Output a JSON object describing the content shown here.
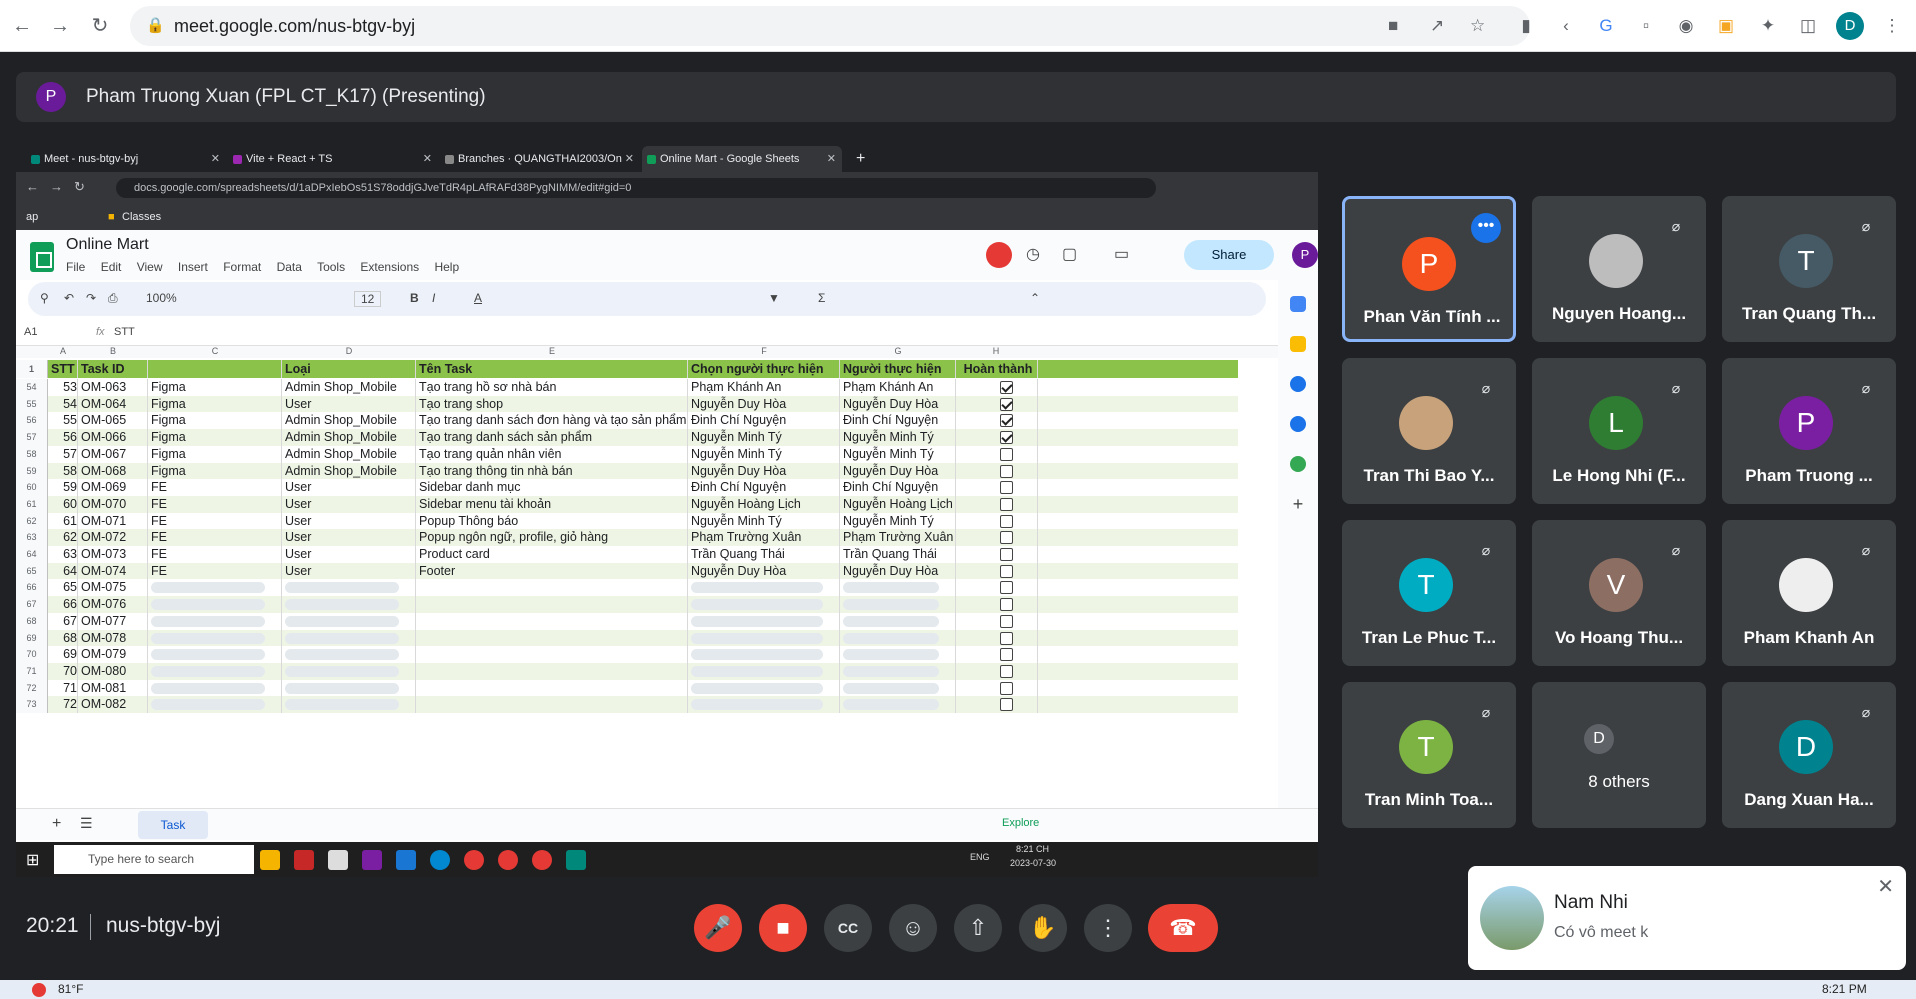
{
  "browser": {
    "url": "meet.google.com/nus-btgv-byj",
    "profile_initial": "D"
  },
  "presenting": {
    "avatar_initial": "P",
    "title": "Pham Truong Xuan (FPL CT_K17) (Presenting)"
  },
  "shared": {
    "tabs": [
      {
        "label": "Meet - nus-btgv-byj"
      },
      {
        "label": "Vite + React + TS"
      },
      {
        "label": "Branches · QUANGTHAI2003/On"
      },
      {
        "label": "Online Mart - Google Sheets"
      }
    ],
    "address": "docs.google.com/spreadsheets/d/1aDPxIebOs51S78oddjGJveTdR4pLAfRAFd38PygNIMM/edit#gid=0",
    "bookmarks": [
      "ap",
      "Classes"
    ],
    "doc_title": "Online Mart",
    "menu": [
      "File",
      "Edit",
      "View",
      "Insert",
      "Format",
      "Data",
      "Tools",
      "Extensions",
      "Help"
    ],
    "share_label": "Share",
    "account_initial": "P",
    "zoom": "100%",
    "font_size": "12",
    "cell_ref": "A1",
    "formula": "STT",
    "col_letters": [
      "A",
      "B",
      "C",
      "D",
      "E",
      "F",
      "G",
      "H"
    ],
    "header": [
      "STT",
      "Task ID",
      "",
      "Loại",
      "Tên Task",
      "Chọn người thực hiện",
      "Người thực hiện",
      "Hoàn thành"
    ],
    "rows": [
      {
        "n": "54",
        "stt": "53",
        "id": "OM-063",
        "c": "Figma",
        "loai": "Admin Shop_Mobile",
        "task": "Tạo trang hồ sơ nhà bán",
        "chon": "Phạm Khánh An",
        "nguoi": "Phạm Khánh An",
        "done": true
      },
      {
        "n": "55",
        "stt": "54",
        "id": "OM-064",
        "c": "Figma",
        "loai": "User",
        "task": "Tạo trang shop",
        "chon": "Nguyễn Duy Hòa",
        "nguoi": "Nguyễn Duy Hòa",
        "done": true
      },
      {
        "n": "56",
        "stt": "55",
        "id": "OM-065",
        "c": "Figma",
        "loai": "Admin Shop_Mobile",
        "task": "Tạo trang danh sách đơn hàng và tạo sản phẩm",
        "chon": "Đinh Chí Nguyện",
        "nguoi": "Đinh Chí Nguyện",
        "done": true
      },
      {
        "n": "57",
        "stt": "56",
        "id": "OM-066",
        "c": "Figma",
        "loai": "Admin Shop_Mobile",
        "task": "Tạo trang danh sách sản phẩm",
        "chon": "Nguyễn Minh Tý",
        "nguoi": "Nguyễn Minh Tý",
        "done": true
      },
      {
        "n": "58",
        "stt": "57",
        "id": "OM-067",
        "c": "Figma",
        "loai": "Admin Shop_Mobile",
        "task": "Tạo trang quản nhân viên",
        "chon": "Nguyễn Minh Tý",
        "nguoi": "Nguyễn Minh Tý",
        "done": false
      },
      {
        "n": "59",
        "stt": "58",
        "id": "OM-068",
        "c": "Figma",
        "loai": "Admin Shop_Mobile",
        "task": "Tạo trang thông tin nhà bán",
        "chon": "Nguyễn Duy Hòa",
        "nguoi": "Nguyễn Duy Hòa",
        "done": false
      },
      {
        "n": "60",
        "stt": "59",
        "id": "OM-069",
        "c": "FE",
        "loai": "User",
        "task": "Sidebar danh mục",
        "chon": "Đinh Chí Nguyện",
        "nguoi": "Đinh Chí Nguyện",
        "done": false
      },
      {
        "n": "61",
        "stt": "60",
        "id": "OM-070",
        "c": "FE",
        "loai": "User",
        "task": "Sidebar menu tài khoản",
        "chon": "Nguyễn Hoàng Lịch",
        "nguoi": "Nguyễn Hoàng Lịch",
        "done": false
      },
      {
        "n": "62",
        "stt": "61",
        "id": "OM-071",
        "c": "FE",
        "loai": "User",
        "task": "Popup Thông báo",
        "chon": "Nguyễn Minh Tý",
        "nguoi": "Nguyễn Minh Tý",
        "done": false
      },
      {
        "n": "63",
        "stt": "62",
        "id": "OM-072",
        "c": "FE",
        "loai": "User",
        "task": "Popup ngôn ngữ, profile, giỏ hàng",
        "chon": "Phạm Trường Xuân",
        "nguoi": "Phạm Trường Xuân",
        "done": false
      },
      {
        "n": "64",
        "stt": "63",
        "id": "OM-073",
        "c": "FE",
        "loai": "User",
        "task": "Product card",
        "chon": "Trần Quang Thái",
        "nguoi": "Trần Quang Thái",
        "done": false
      },
      {
        "n": "65",
        "stt": "64",
        "id": "OM-074",
        "c": "FE",
        "loai": "User",
        "task": "Footer",
        "chon": "Nguyễn Duy Hòa",
        "nguoi": "Nguyễn Duy Hòa",
        "done": false
      },
      {
        "n": "66",
        "stt": "65",
        "id": "OM-075",
        "c": "",
        "loai": "",
        "task": "",
        "chon": "",
        "nguoi": "",
        "done": false
      },
      {
        "n": "67",
        "stt": "66",
        "id": "OM-076",
        "c": "",
        "loai": "",
        "task": "",
        "chon": "",
        "nguoi": "",
        "done": false
      },
      {
        "n": "68",
        "stt": "67",
        "id": "OM-077",
        "c": "",
        "loai": "",
        "task": "",
        "chon": "",
        "nguoi": "",
        "done": false
      },
      {
        "n": "69",
        "stt": "68",
        "id": "OM-078",
        "c": "",
        "loai": "",
        "task": "",
        "chon": "",
        "nguoi": "",
        "done": false
      },
      {
        "n": "70",
        "stt": "69",
        "id": "OM-079",
        "c": "",
        "loai": "",
        "task": "",
        "chon": "",
        "nguoi": "",
        "done": false
      },
      {
        "n": "71",
        "stt": "70",
        "id": "OM-080",
        "c": "",
        "loai": "",
        "task": "",
        "chon": "",
        "nguoi": "",
        "done": false
      },
      {
        "n": "72",
        "stt": "71",
        "id": "OM-081",
        "c": "",
        "loai": "",
        "task": "",
        "chon": "",
        "nguoi": "",
        "done": false
      },
      {
        "n": "73",
        "stt": "72",
        "id": "OM-082",
        "c": "",
        "loai": "",
        "task": "",
        "chon": "",
        "nguoi": "",
        "done": false
      }
    ],
    "sheet_tab": "Task",
    "explore": "Explore",
    "taskbar_search": "Type here to search",
    "taskbar_lang": "ENG",
    "taskbar_time": "8:21 CH",
    "taskbar_date": "2023-07-30"
  },
  "participants": [
    {
      "name": "Phan Văn Tính ...",
      "initial": "P",
      "color": "#f4511e",
      "muted": false
    },
    {
      "name": "Nguyen Hoang...",
      "initial": "",
      "color": "#bdbdbd",
      "muted": true
    },
    {
      "name": "Tran Quang Th...",
      "initial": "T",
      "color": "#455a64",
      "muted": true
    },
    {
      "name": "Tran Thi Bao Y...",
      "initial": "",
      "color": "#c8a27a",
      "muted": true
    },
    {
      "name": "Le Hong Nhi (F...",
      "initial": "L",
      "color": "#2e7d32",
      "muted": true
    },
    {
      "name": "Pham Truong ...",
      "initial": "P",
      "color": "#7b1fa2",
      "muted": true
    },
    {
      "name": "Tran Le Phuc T...",
      "initial": "T",
      "color": "#00acc1",
      "muted": true
    },
    {
      "name": "Vo Hoang Thu...",
      "initial": "V",
      "color": "#8d6e63",
      "muted": true
    },
    {
      "name": "Pham Khanh An",
      "initial": "",
      "color": "#eeeeee",
      "muted": true
    },
    {
      "name": "Tran Minh Toa...",
      "initial": "T",
      "color": "#7cb342",
      "muted": true
    },
    {
      "name": "8 others",
      "initial": "D",
      "color": "#3c4043",
      "muted": false
    },
    {
      "name": "Dang Xuan Ha...",
      "initial": "D",
      "color": "#00838f",
      "muted": true
    }
  ],
  "meeting": {
    "time": "20:21",
    "code": "nus-btgv-byj"
  },
  "notification": {
    "name": "Nam Nhi",
    "message": "Có vô meet k"
  },
  "os": {
    "weather": "81°F",
    "time": "8:21 PM"
  },
  "colors": {
    "header_green": "#8bc34a",
    "end_call": "#ea4335",
    "speaking_border": "#8ab4f8"
  }
}
